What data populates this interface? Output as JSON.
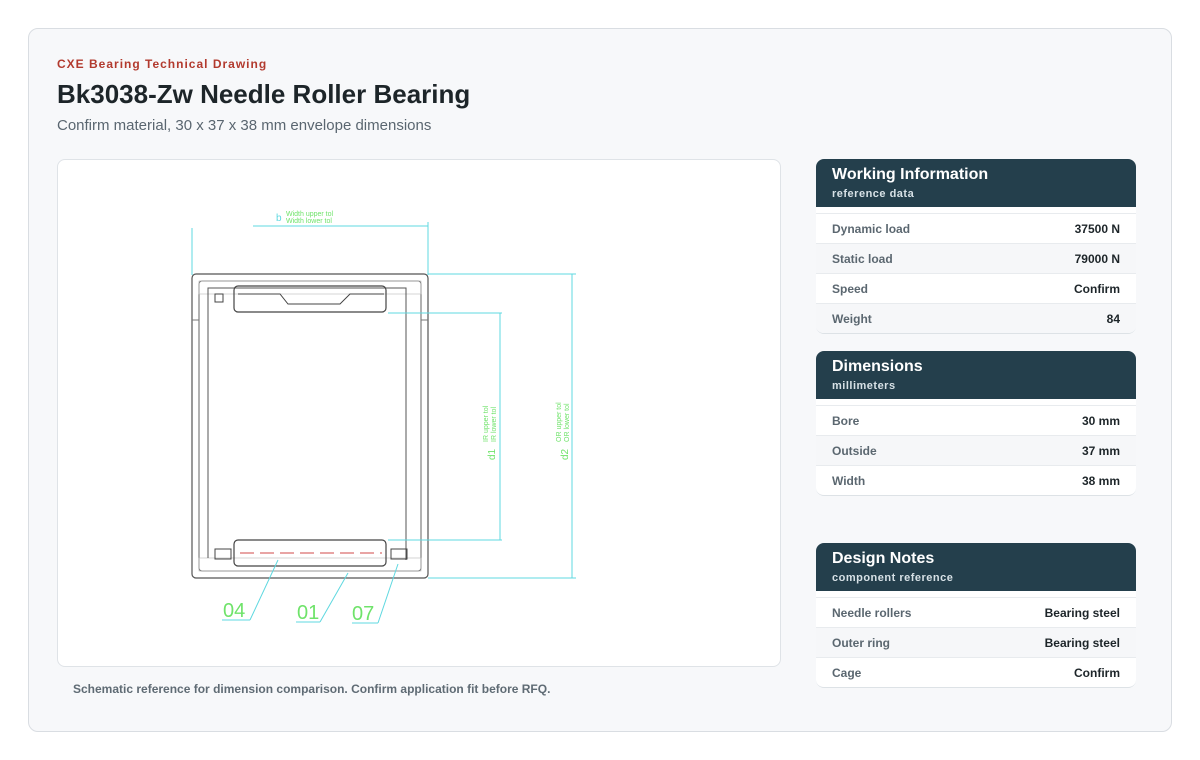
{
  "header": {
    "eyebrow": "CXE Bearing Technical Drawing",
    "title": "Bk3038-Zw Needle Roller Bearing",
    "subtitle": "Confirm material, 30 x 37 x 38 mm envelope dimensions"
  },
  "drawing": {
    "width_label": "b",
    "width_tol_upper": "Width upper tol",
    "width_tol_lower": "Width lower tol",
    "d1_label": "d1",
    "d1_tol_upper": "IR upper tol",
    "d1_tol_lower": "IR lower tol",
    "d2_label": "d2",
    "d2_tol_upper": "OR upper tol",
    "d2_tol_lower": "OR lower tol",
    "callouts": [
      "04",
      "01",
      "07"
    ],
    "caption": "Schematic reference for dimension comparison. Confirm application fit before RFQ."
  },
  "working_info": {
    "title": "Working Information",
    "subtitle": "reference data",
    "rows": [
      {
        "label": "Dynamic load",
        "value": "37500 N"
      },
      {
        "label": "Static load",
        "value": "79000 N"
      },
      {
        "label": "Speed",
        "value": "Confirm"
      },
      {
        "label": "Weight",
        "value": "84"
      }
    ]
  },
  "dimensions": {
    "title": "Dimensions",
    "subtitle": "millimeters",
    "rows": [
      {
        "label": "Bore",
        "value": "30 mm"
      },
      {
        "label": "Outside",
        "value": "37 mm"
      },
      {
        "label": "Width",
        "value": "38 mm"
      }
    ]
  },
  "design_notes": {
    "title": "Design Notes",
    "subtitle": "component reference",
    "rows": [
      {
        "label": "Needle rollers",
        "value": "Bearing steel"
      },
      {
        "label": "Outer ring",
        "value": "Bearing steel"
      },
      {
        "label": "Cage",
        "value": "Confirm"
      }
    ]
  },
  "colors": {
    "accent": "#b23a2e",
    "header_bg": "#243f4c",
    "dimension_line": "#5fd8e0",
    "callout_green": "#6fe36a"
  }
}
